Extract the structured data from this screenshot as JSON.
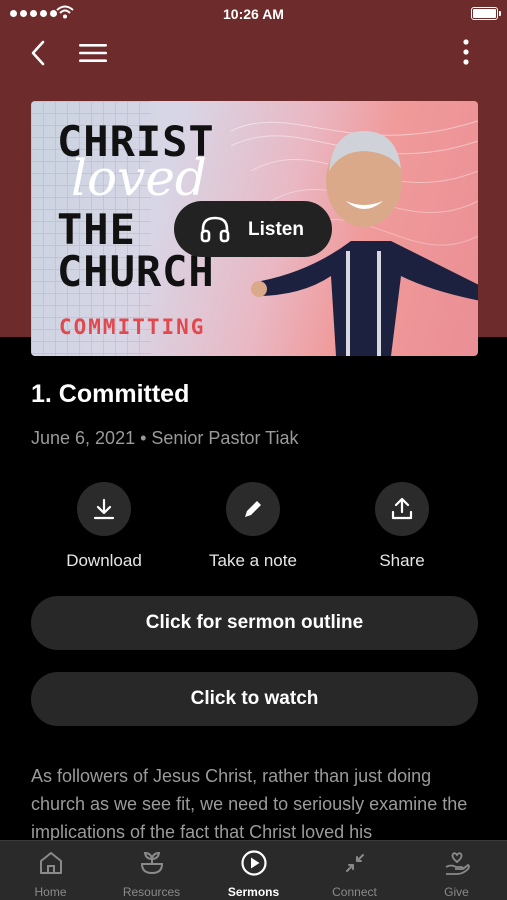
{
  "status_bar": {
    "time": "10:26 AM"
  },
  "nav": {
    "back_icon": "chevron-left-icon",
    "menu_icon": "hamburger-icon",
    "more_icon": "vertical-ellipsis-icon"
  },
  "cover": {
    "line1": "CHRIST",
    "line2": "loved",
    "line3": "THE",
    "line4": "CHURCH",
    "series": "COMMITTING"
  },
  "listen_button": {
    "label": "Listen",
    "icon": "headphones-icon"
  },
  "sermon": {
    "title": "1. Committed",
    "meta": "June 6, 2021 • Senior Pastor Tiak",
    "description": "As followers of Jesus Christ, rather than just doing church as we see fit, we need to seriously examine the implications of the fact that Christ loved his"
  },
  "actions": [
    {
      "label": "Download",
      "icon": "download-icon"
    },
    {
      "label": "Take a note",
      "icon": "pencil-icon"
    },
    {
      "label": "Share",
      "icon": "share-icon"
    }
  ],
  "buttons": {
    "outline": "Click for sermon outline",
    "watch": "Click to watch"
  },
  "tabs": [
    {
      "label": "Home",
      "icon": "home-icon",
      "active": false
    },
    {
      "label": "Resources",
      "icon": "sprout-bowl-icon",
      "active": false
    },
    {
      "label": "Sermons",
      "icon": "play-circle-icon",
      "active": true
    },
    {
      "label": "Connect",
      "icon": "arrows-connect-icon",
      "active": false
    },
    {
      "label": "Give",
      "icon": "hand-heart-icon",
      "active": false
    }
  ],
  "colors": {
    "hero_background": "#6e2b2c",
    "series_text": "#e04a4f",
    "button_background": "#282828"
  }
}
